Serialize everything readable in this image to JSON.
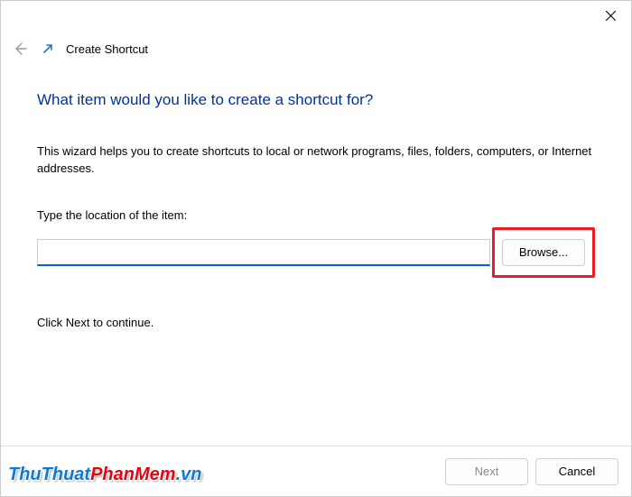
{
  "header": {
    "title": "Create Shortcut"
  },
  "main": {
    "heading": "What item would you like to create a shortcut for?",
    "description": "This wizard helps you to create shortcuts to local or network programs, files, folders, computers, or Internet addresses.",
    "location_label": "Type the location of the item:",
    "location_value": "",
    "browse_label": "Browse...",
    "continue_hint": "Click Next to continue."
  },
  "footer": {
    "next_label": "Next",
    "cancel_label": "Cancel"
  },
  "watermark": {
    "part1": "ThuThuat",
    "part2": "PhanMem",
    "part3": ".vn"
  }
}
